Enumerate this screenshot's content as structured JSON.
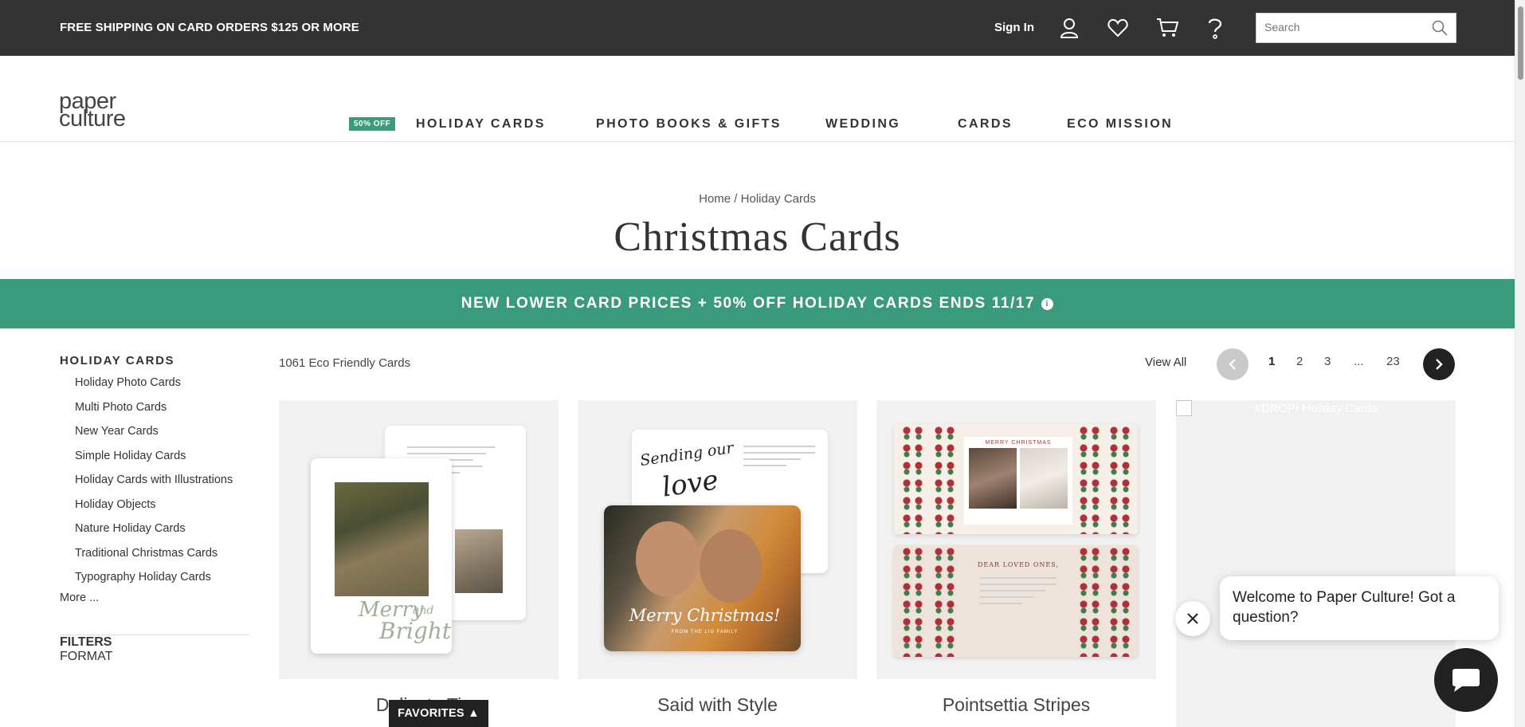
{
  "topbar": {
    "promo": "FREE SHIPPING ON CARD ORDERS $125 OR MORE",
    "signin": "Sign In",
    "search_placeholder": "Search",
    "icons": [
      "user-icon",
      "heart-icon",
      "cart-icon",
      "help-icon",
      "search-icon"
    ]
  },
  "header": {
    "logo_line1": "paper",
    "logo_line2": "culture",
    "badge": "50% OFF",
    "nav": [
      "HOLIDAY CARDS",
      "PHOTO BOOKS & GIFTS",
      "WEDDING",
      "CARDS",
      "ECO MISSION"
    ]
  },
  "breadcrumb": {
    "home": "Home",
    "sep": " / ",
    "current": "Holiday Cards"
  },
  "page_title": "Christmas Cards",
  "banner": {
    "text": "NEW LOWER CARD PRICES + 50% OFF HOLIDAY CARDS ENDS 11/17",
    "info_icon": "i"
  },
  "sidebar": {
    "category_title": "HOLIDAY CARDS",
    "items": [
      "Holiday Photo Cards",
      "Multi Photo Cards",
      "New Year Cards",
      "Simple Holiday Cards",
      "Holiday Cards with Illustrations",
      "Holiday Objects",
      "Nature Holiday Cards",
      "Traditional Christmas Cards",
      "Typography Holiday Cards"
    ],
    "more": "More ...",
    "filters_label": "FILTERS",
    "format_label": "FORMAT"
  },
  "results": {
    "count": "1061 Eco Friendly Cards",
    "view_all": "View All",
    "pages": [
      "1",
      "2",
      "3",
      "...",
      "23"
    ],
    "current_page": "1"
  },
  "products": [
    {
      "name": "Delicate Ti",
      "script_1": "Merry",
      "script_2": "and",
      "script_3": "Bright"
    },
    {
      "name": "Said with Style",
      "script_1": "Sending our",
      "script_2": "love",
      "script_3": "Merry Christmas!",
      "sub": "FROM THE LIU FAMILY"
    },
    {
      "name": "Pointsettia Stripes",
      "top_text": "MERRY CHRISTMAS",
      "bot_text": "DEAR LOVED ONES,"
    },
    {
      "alt": "#DROP! Holiday Cards"
    }
  ],
  "chat": {
    "message": "Welcome to Paper Culture! Got a question?"
  },
  "favorites": {
    "label": "FAVORITES",
    "arrow": "▲"
  },
  "colors": {
    "topbar": "#333333",
    "accent_green": "#3a9a7c",
    "text": "#333333"
  }
}
